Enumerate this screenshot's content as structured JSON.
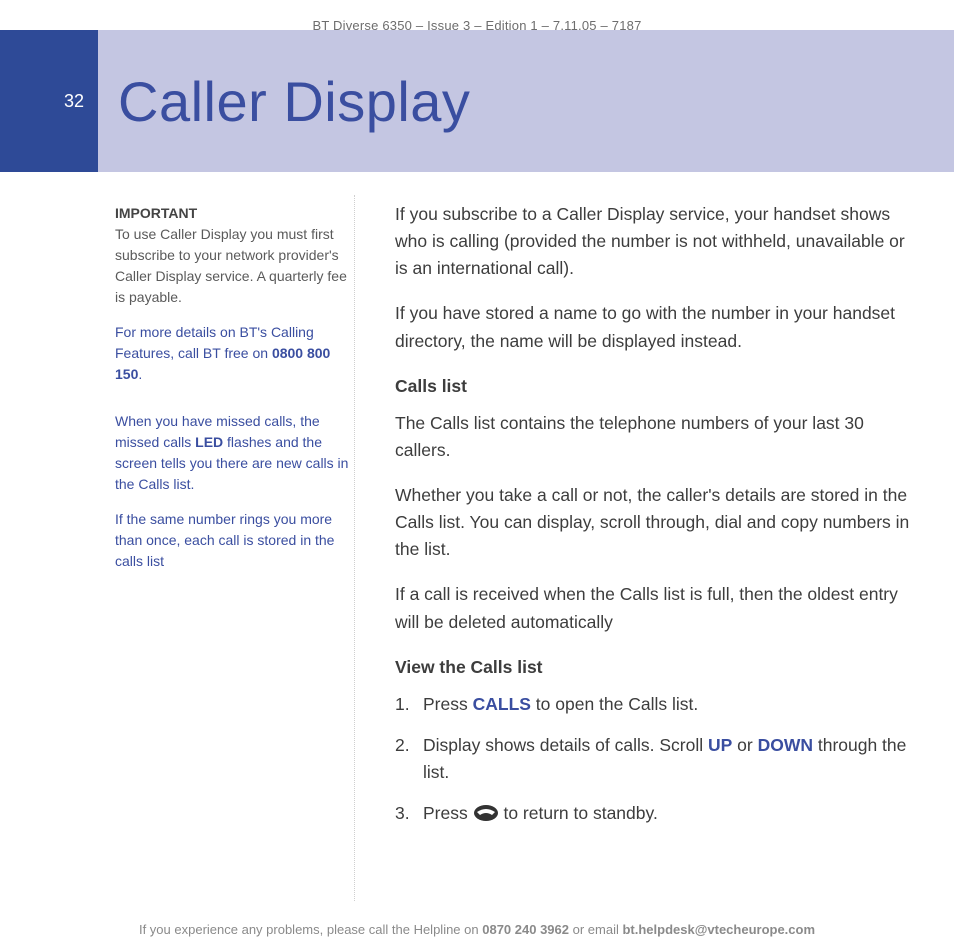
{
  "header": {
    "running": "BT Diverse 6350 – Issue 3 – Edition 1 – 7.11.05 – 7187",
    "page_number": "32",
    "title": "Caller Display"
  },
  "sidebar": {
    "important_label": "IMPORTANT",
    "important_text": "To use Caller Display you must first subscribe to your network provider's Caller Display service. A quarterly fee is payable.",
    "more_details_prefix": "For more details on BT's Calling Features, call BT free on ",
    "more_details_number": "0800 800 150",
    "more_details_suffix": ".",
    "missed_pre": "When you have missed calls, the missed calls ",
    "missed_led": "LED",
    "missed_post": " flashes and the screen tells you there are new calls in the Calls list.",
    "same_number": "If the same number rings you more than once, each call is stored in the calls list"
  },
  "main": {
    "intro1": "If you subscribe to a Caller Display service, your handset shows who is calling (provided the number is not withheld, unavailable or is an international call).",
    "intro2": "If you have stored a name to go with the number in your handset directory, the name will be displayed instead.",
    "calls_list_heading": "Calls list",
    "calls_list_p1": "The Calls list contains the telephone numbers of your last 30 callers.",
    "calls_list_p2": "Whether you take a call or not, the caller's details are stored in the Calls list. You can display, scroll through, dial and copy numbers in the list.",
    "calls_list_p3": "If a call is received when the Calls list is full, then the oldest entry will be deleted automatically",
    "view_heading": "View the Calls list",
    "step1_pre": "Press ",
    "step1_key": "CALLS",
    "step1_post": " to open the Calls list.",
    "step2_pre": "Display shows details of calls. Scroll ",
    "step2_up": "UP",
    "step2_or": " or ",
    "step2_down": "DOWN",
    "step2_post": " through the list.",
    "step3_pre": "Press ",
    "step3_post": " to return to standby."
  },
  "footer": {
    "pre": "If you experience any problems, please call the Helpline on ",
    "phone": "0870 240 3962",
    "mid": " or email ",
    "email": "bt.helpdesk@vtecheurope.com"
  }
}
